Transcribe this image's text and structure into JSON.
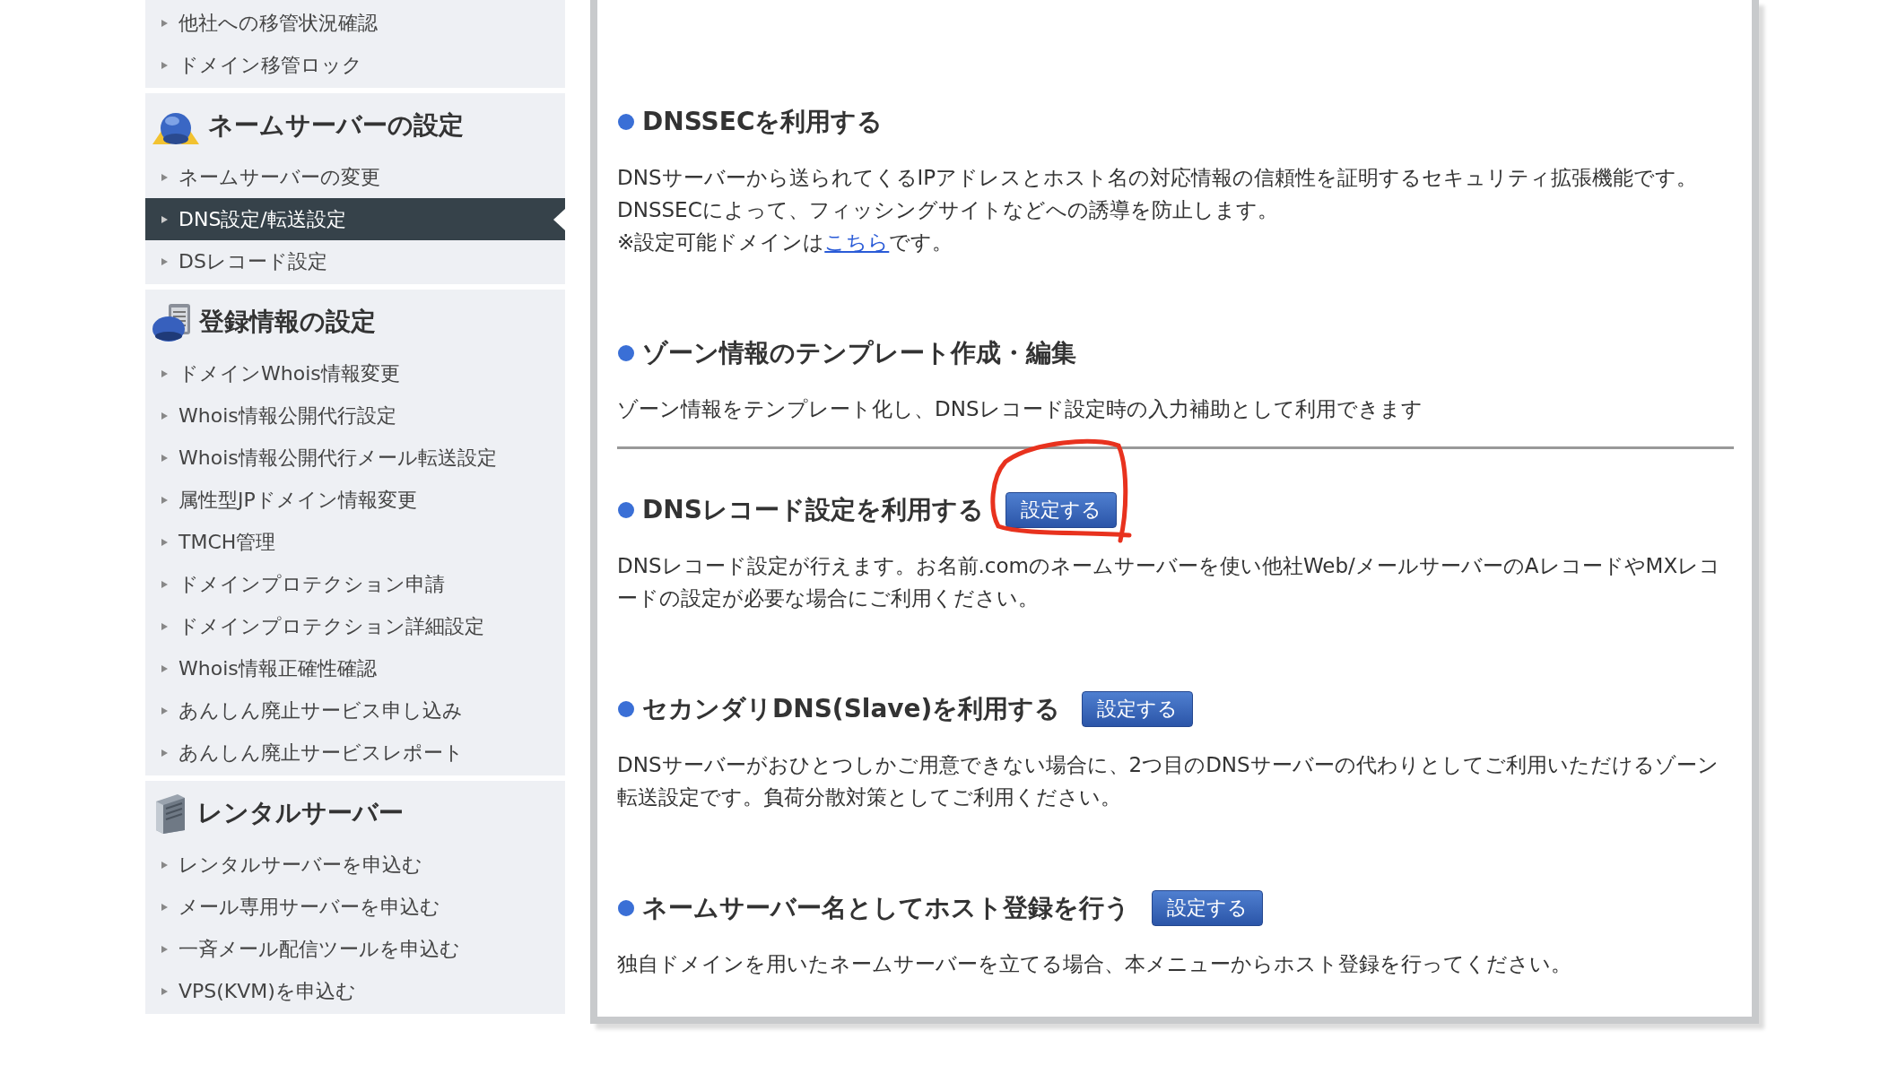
{
  "sidebar": {
    "groups": [
      {
        "items": [
          {
            "label": "他社への移管状況確認",
            "selected": false
          },
          {
            "label": "ドメイン移管ロック",
            "selected": false
          }
        ]
      },
      {
        "header": "ネームサーバーの設定",
        "items": [
          {
            "label": "ネームサーバーの変更",
            "selected": false
          },
          {
            "label": "DNS設定/転送設定",
            "selected": true
          },
          {
            "label": "DSレコード設定",
            "selected": false
          }
        ]
      },
      {
        "header": "登録情報の設定",
        "items": [
          {
            "label": "ドメインWhois情報変更",
            "selected": false
          },
          {
            "label": "Whois情報公開代行設定",
            "selected": false
          },
          {
            "label": "Whois情報公開代行メール転送設定",
            "selected": false
          },
          {
            "label": "属性型JPドメイン情報変更",
            "selected": false
          },
          {
            "label": "TMCH管理",
            "selected": false
          },
          {
            "label": "ドメインプロテクション申請",
            "selected": false
          },
          {
            "label": "ドメインプロテクション詳細設定",
            "selected": false
          },
          {
            "label": "Whois情報正確性確認",
            "selected": false
          },
          {
            "label": "あんしん廃止サービス申し込み",
            "selected": false
          },
          {
            "label": "あんしん廃止サービスレポート",
            "selected": false
          }
        ]
      },
      {
        "header": "レンタルサーバー",
        "items": [
          {
            "label": "レンタルサーバーを申込む",
            "selected": false
          },
          {
            "label": "メール専用サーバーを申込む",
            "selected": false
          },
          {
            "label": "一斉メール配信ツールを申込む",
            "selected": false
          },
          {
            "label": "VPS(KVM)を申込む",
            "selected": false
          }
        ]
      }
    ]
  },
  "sections": [
    {
      "title": "DNSSECを利用する",
      "annotated": false,
      "divider_after": false,
      "paragraphs": [
        {
          "text": "DNSサーバーから送られてくるIPアドレスとホスト名の対応情報の信頼性を証明するセキュリティ拡張機能です。"
        },
        {
          "text": "DNSSECによって、フィッシングサイトなどへの誘導を防止します。"
        },
        {
          "text": "※設定可能ドメインは",
          "link": "こちら",
          "after": "です。"
        }
      ]
    },
    {
      "title": "ゾーン情報のテンプレート作成・編集",
      "annotated": false,
      "divider_after": true,
      "paragraphs": [
        {
          "text": "ゾーン情報をテンプレート化し、DNSレコード設定時の入力補助として利用できます"
        }
      ]
    },
    {
      "title": "DNSレコード設定を利用する",
      "button": "設定する",
      "annotated": true,
      "divider_after": false,
      "paragraphs": [
        {
          "text": "DNSレコード設定が行えます。お名前.comのネームサーバーを使い他社Web/メールサーバーのAレコードやMXレコードの設定が必要な場合にご利用ください。"
        }
      ]
    },
    {
      "title": "セカンダリDNS(Slave)を利用する",
      "button": "設定する",
      "annotated": false,
      "divider_after": false,
      "paragraphs": [
        {
          "text": "DNSサーバーがおひとつしかご用意できない場合に、2つ目のDNSサーバーの代わりとしてご利用いただけるゾーン転送設定です。負荷分散対策としてご利用ください。"
        }
      ]
    },
    {
      "title": "ネームサーバー名としてホスト登録を行う",
      "button": "設定する",
      "annotated": false,
      "divider_after": false,
      "paragraphs": [
        {
          "text": "独自ドメインを用いたネームサーバーを立てる場合、本メニューからホスト登録を行ってください。"
        }
      ]
    }
  ]
}
